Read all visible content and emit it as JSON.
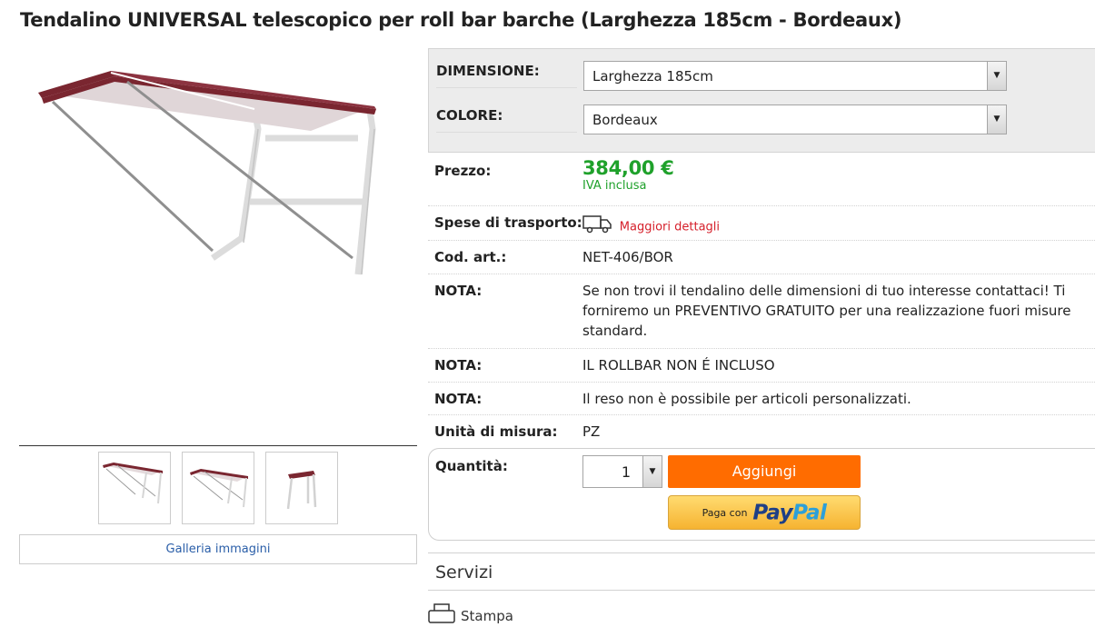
{
  "product": {
    "title": "Tendalino UNIVERSAL telescopico per roll bar barche (Larghezza 185cm - Bordeaux)"
  },
  "colors": {
    "canopy": "#7a2630",
    "price": "#1fa12b",
    "link": "#d51e29",
    "add_button": "#ff6c00"
  },
  "gallery": {
    "button_label": "Galleria immagini",
    "thumbnails": [
      "thumb-1",
      "thumb-2",
      "thumb-3"
    ]
  },
  "variants": {
    "dimension_label": "DIMENSIONE:",
    "dimension_value": "Larghezza 185cm",
    "color_label": "COLORE:",
    "color_value": "Bordeaux"
  },
  "details": {
    "price_label": "Prezzo:",
    "price_value": "384,00 €",
    "vat_note": "IVA inclusa",
    "shipping_label": "Spese di trasporto:",
    "shipping_icon": "truck-icon",
    "shipping_link": "Maggiori dettagli",
    "code_label": "Cod. art.:",
    "code_value": "NET-406/BOR",
    "note1_label": "NOTA:",
    "note1_value": "Se non trovi il tendalino delle dimensioni di tuo interesse contattaci! Ti forniremo un PREVENTIVO GRATUITO per una realizzazione fuori misure standard.",
    "note2_label": "NOTA:",
    "note2_value": "IL ROLLBAR NON É INCLUSO",
    "note3_label": "NOTA:",
    "note3_value": "Il reso non è possibile per articoli personalizzati.",
    "unit_label": "Unità di misura:",
    "unit_value": "PZ"
  },
  "purchase": {
    "qty_label": "Quantità:",
    "qty_value": "1",
    "add_button": "Aggiungi",
    "paypal_prefix": "Paga con",
    "paypal_brand_a": "Pay",
    "paypal_brand_b": "Pal"
  },
  "services": {
    "heading": "Servizi",
    "print_label": "Stampa",
    "print_icon": "printer-icon"
  }
}
